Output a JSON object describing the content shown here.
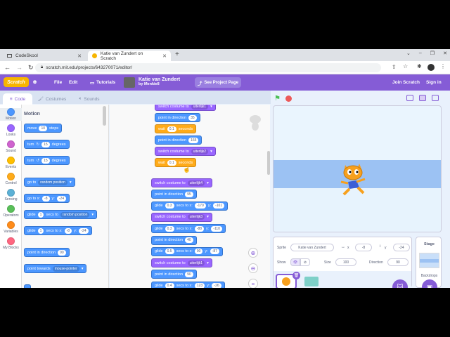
{
  "browser": {
    "tabs": [
      {
        "title": "CodeSkool"
      },
      {
        "title": "Katie van Zundert on Scratch"
      }
    ],
    "url": "scratch.mit.edu/projects/643270071/editor/"
  },
  "menubar": {
    "logo": "Scratch",
    "file": "File",
    "edit": "Edit",
    "tutorials": "Tutorials",
    "project_title": "Katie van Zundert",
    "project_author": "by Menkie8",
    "see_project": "See Project Page",
    "join": "Join Scratch",
    "signin": "Sign in"
  },
  "editor_tabs": {
    "code": "Code",
    "costumes": "Costumes",
    "sounds": "Sounds"
  },
  "categories": [
    {
      "label": "Motion",
      "color": "#4c97ff"
    },
    {
      "label": "Looks",
      "color": "#9966ff"
    },
    {
      "label": "Sound",
      "color": "#cf63cf"
    },
    {
      "label": "Events",
      "color": "#ffbf00"
    },
    {
      "label": "Control",
      "color": "#ffab19"
    },
    {
      "label": "Sensing",
      "color": "#5cb1d6"
    },
    {
      "label": "Operators",
      "color": "#59c059"
    },
    {
      "label": "Variables",
      "color": "#ff8c1a"
    },
    {
      "label": "My Blocks",
      "color": "#ff6680"
    }
  ],
  "palette": {
    "heading": "Motion",
    "move": {
      "a": "move",
      "v": "10",
      "b": "steps"
    },
    "turn_right": {
      "a": "turn",
      "v": "15",
      "b": "degrees"
    },
    "turn_left": {
      "a": "turn",
      "v": "15",
      "b": "degrees"
    },
    "goto": {
      "a": "go to",
      "d": "random position"
    },
    "gotoxy": {
      "a": "go to x:",
      "x": "-8",
      "b": "y:",
      "y": "-24"
    },
    "glide_to": {
      "a": "glide",
      "v": "1",
      "b": "secs to",
      "d": "random position"
    },
    "glide_xy": {
      "a": "glide",
      "v": "1",
      "b": "secs to x:",
      "x": "-8",
      "c": "y:",
      "y": "-24"
    },
    "point_dir": {
      "a": "point in direction",
      "v": "90"
    },
    "point_towards": {
      "a": "point towards",
      "d": "mouse-pointer"
    }
  },
  "script": [
    {
      "kind": "looks",
      "a": "switch costume to",
      "d": "uiterlijk1"
    },
    {
      "kind": "motion",
      "a": "point in direction",
      "v": "35"
    },
    {
      "kind": "ctrl",
      "a": "wait",
      "v": "0.1",
      "b": "seconds"
    },
    {
      "kind": "motion",
      "a": "point in direction",
      "v": "165"
    },
    {
      "kind": "looks",
      "a": "switch costume to",
      "d": "uiterlijk2"
    },
    {
      "kind": "ctrl",
      "a": "wait",
      "v": "0.1",
      "b": "seconds"
    },
    {
      "kind": "looks",
      "a": "switch costume to",
      "d": "uiterlijk4"
    },
    {
      "kind": "motion",
      "a": "point in direction",
      "v": "95"
    },
    {
      "kind": "motion",
      "a": "glide",
      "v": "0.3",
      "b": "secs to x:",
      "x": "-170",
      "c": "y:",
      "y": "-101"
    },
    {
      "kind": "looks",
      "a": "switch costume to",
      "d": "uiterlijk3"
    },
    {
      "kind": "motion",
      "a": "glide",
      "v": "0.3",
      "b": "secs to x:",
      "x": "-88",
      "c": "y:",
      "y": "-110"
    },
    {
      "kind": "motion",
      "a": "point in direction",
      "v": "40"
    },
    {
      "kind": "motion",
      "a": "glide",
      "v": "0.5",
      "b": "secs to x:",
      "x": "90",
      "c": "y:",
      "y": "-87"
    },
    {
      "kind": "looks",
      "a": "switch costume to",
      "d": "uiterlijk1"
    },
    {
      "kind": "motion",
      "a": "point in direction",
      "v": "90"
    },
    {
      "kind": "motion",
      "a": "glide",
      "v": "0.4",
      "b": "secs to x:",
      "x": "123",
      "c": "y:",
      "y": "-26"
    }
  ],
  "sprite_info": {
    "sprite_label": "Sprite",
    "sprite_name": "Katie van Zundert",
    "x_label": "x",
    "x": "-8",
    "y_label": "y",
    "y": "-24",
    "show_label": "Show",
    "size_label": "Size",
    "size": "100",
    "direction_label": "Direction",
    "direction": "90"
  },
  "stage_pane": {
    "title": "Stage",
    "backdrops": "Backdrops"
  }
}
